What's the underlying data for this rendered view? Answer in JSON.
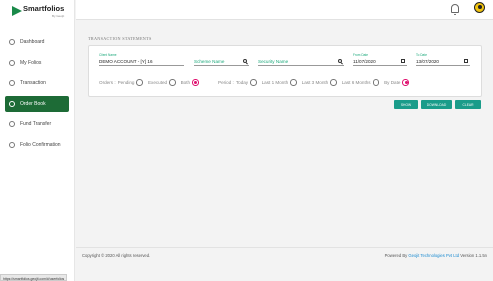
{
  "brand": {
    "name": "Smartfolios",
    "sub": "By Geojit"
  },
  "sidebar": {
    "items": [
      {
        "label": "Dashboard",
        "icon": "dashboard-icon",
        "active": false
      },
      {
        "label": "My Folios",
        "icon": "folio-icon",
        "active": false
      },
      {
        "label": "Transaction",
        "icon": "transaction-icon",
        "active": false
      },
      {
        "label": "Order Book",
        "icon": "order-book-icon",
        "active": true
      },
      {
        "label": "Fund Transfer",
        "icon": "fund-transfer-icon",
        "active": false
      },
      {
        "label": "Folio Confirmation",
        "icon": "folio-confirmation-icon",
        "active": false
      }
    ]
  },
  "page": {
    "title": "TRANSACTION STATEMENTS"
  },
  "filters": {
    "client": {
      "label": "Client Name",
      "value": "DEMO ACCOUNT - [Y] 16"
    },
    "scheme": {
      "placeholder": "Scheme Name"
    },
    "security": {
      "placeholder": "Security Name"
    },
    "from_date": {
      "label": "From Date",
      "value": "11/07/2020"
    },
    "to_date": {
      "label": "To Date",
      "value": "13/07/2020"
    }
  },
  "orders": {
    "label": "Orders :",
    "options": [
      {
        "label": "Pending",
        "checked": false
      },
      {
        "label": "Executed",
        "checked": false
      },
      {
        "label": "Both",
        "checked": true
      }
    ]
  },
  "period": {
    "label": "Period :",
    "options": [
      {
        "label": "Today",
        "checked": false
      },
      {
        "label": "Last 1 Month",
        "checked": false
      },
      {
        "label": "Last 3 Month",
        "checked": false
      },
      {
        "label": "Last 6 Months",
        "checked": false
      },
      {
        "label": "By Date",
        "checked": true
      }
    ]
  },
  "actions": {
    "show": "SHOW",
    "download": "DOWNLOAD",
    "clear": "CLEAR"
  },
  "footer": {
    "copyright": "Copyright © 2020 All rights reserved.",
    "powered_prefix": "Powered By",
    "powered_link": "Geojit Technologies Pvt Ltd",
    "version": "Version 1.1.5n"
  },
  "status_url": "https://smartfolios.geojit.com/#/userfolios",
  "colors": {
    "accent": "#1d6b36",
    "button": "#1a9c8a",
    "radio_checked": "#e0116f",
    "field_label": "#1aa87a"
  }
}
